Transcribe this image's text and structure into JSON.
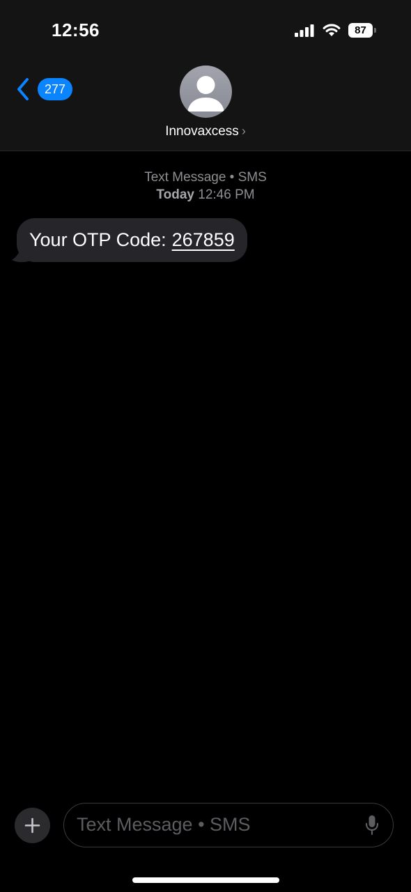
{
  "status_bar": {
    "time": "12:56",
    "battery_level": "87",
    "signal_icon": "cellular-signal-icon",
    "wifi_icon": "wifi-icon"
  },
  "nav": {
    "back_icon": "chevron-left-icon",
    "back_badge": "277",
    "contact_name": "Innovaxcess",
    "contact_chevron": "›",
    "avatar_icon": "person-silhouette-icon"
  },
  "conversation": {
    "service_label": "Text Message • SMS",
    "date_label": "Today",
    "time_label": "12:46 PM",
    "messages": [
      {
        "direction": "incoming",
        "text": "Your OTP Code:",
        "code": "267859"
      }
    ]
  },
  "input_bar": {
    "plus_icon": "plus-icon",
    "placeholder": "Text Message • SMS",
    "value": "",
    "mic_icon": "microphone-icon"
  },
  "colors": {
    "accent": "#0a84ff",
    "bubble_incoming": "#26252a",
    "header_bg": "#141414",
    "secondary_text": "#8e8e93"
  }
}
